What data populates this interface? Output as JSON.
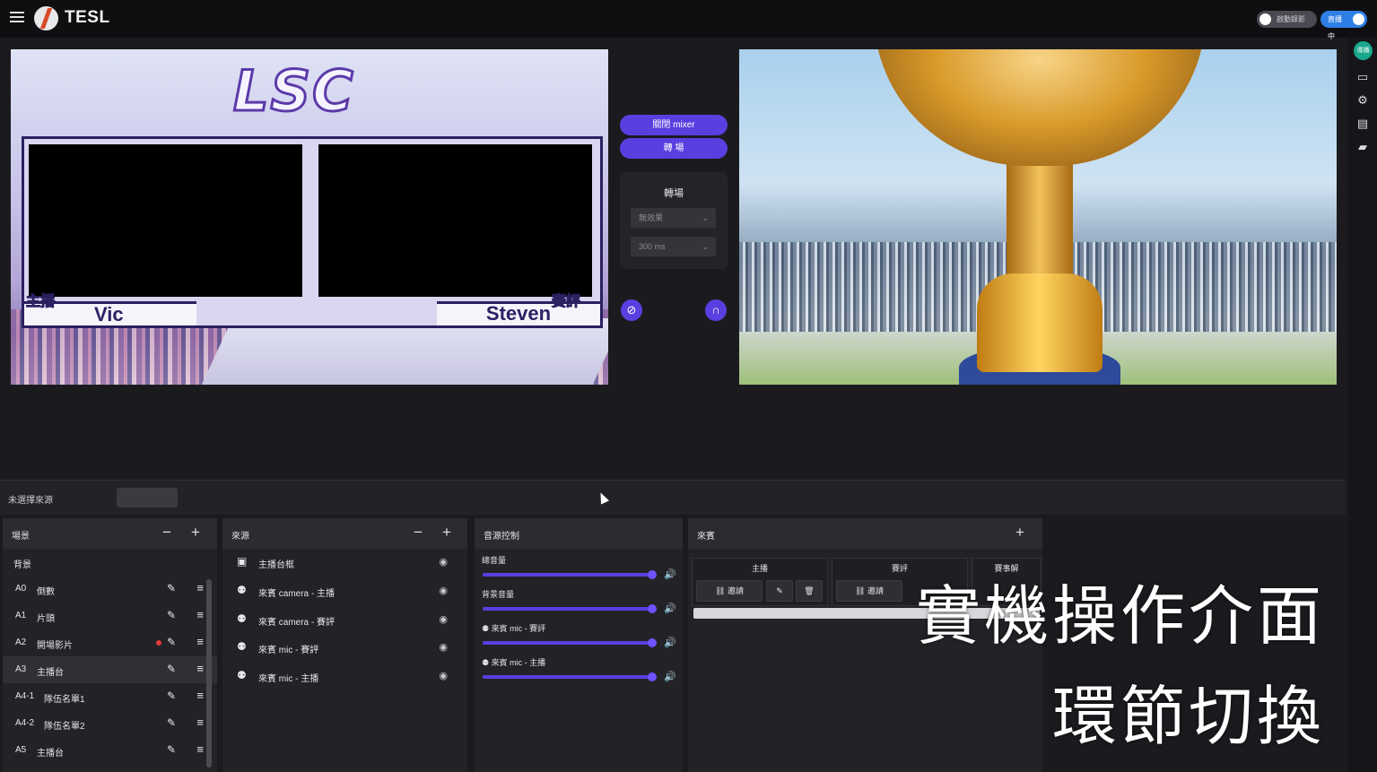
{
  "app": {
    "logo": "TESL"
  },
  "header": {
    "record_toggle": "啟動錄影",
    "live_toggle": "直播中"
  },
  "sidebar_right": {
    "avatar": "導播"
  },
  "preview": {
    "logo_text": "LSC",
    "left_role": "主播",
    "left_name": "Vic",
    "right_role": "賽評",
    "right_name": "Steven"
  },
  "mixer": {
    "close_mixer": "關閉 mixer",
    "transition_button": "轉 場",
    "transition_title": "轉場",
    "effect_select": "無效果",
    "duration_select": "300 ms"
  },
  "source_bar": {
    "label": "未選擇來源"
  },
  "scenes": {
    "title": "場景",
    "background_label": "背景",
    "items": [
      {
        "key": "A0",
        "name": "倒數"
      },
      {
        "key": "A1",
        "name": "片頭"
      },
      {
        "key": "A2",
        "name": "開場影片"
      },
      {
        "key": "A3",
        "name": "主播台"
      },
      {
        "key": "A4-1",
        "name": "隊伍名單1"
      },
      {
        "key": "A4-2",
        "name": "隊伍名單2"
      },
      {
        "key": "A5",
        "name": "主播台"
      }
    ]
  },
  "sources": {
    "title": "來源",
    "items": [
      {
        "name": "主播台框",
        "icon": "image-icon"
      },
      {
        "name": "來賓 camera - 主播",
        "icon": "person-icon"
      },
      {
        "name": "來賓 camera - 賽評",
        "icon": "person-icon"
      },
      {
        "name": "來賓 mic - 賽評",
        "icon": "person-icon"
      },
      {
        "name": "來賓 mic - 主播",
        "icon": "person-icon"
      }
    ]
  },
  "audio": {
    "title": "音源控制",
    "channels": [
      {
        "label": "總音量",
        "level": 1.0,
        "guest": false
      },
      {
        "label": "背景音量",
        "level": 1.0,
        "guest": false
      },
      {
        "label": "來賓 mic - 賽評",
        "level": 1.0,
        "guest": true
      },
      {
        "label": "來賓 mic - 主播",
        "level": 1.0,
        "guest": true
      }
    ]
  },
  "guests": {
    "title": "來賓",
    "cards": [
      {
        "title": "主播",
        "invite": "邀請"
      },
      {
        "title": "賽評",
        "invite": "邀請"
      },
      {
        "title": "賽事解",
        "invite": ""
      }
    ]
  },
  "overlay": {
    "line1": "實機操作介面",
    "line2": "環節切換"
  },
  "colors": {
    "accent": "#5a3fe0",
    "live": "#2f7fe6",
    "recording_dot": "#e23a3a"
  }
}
